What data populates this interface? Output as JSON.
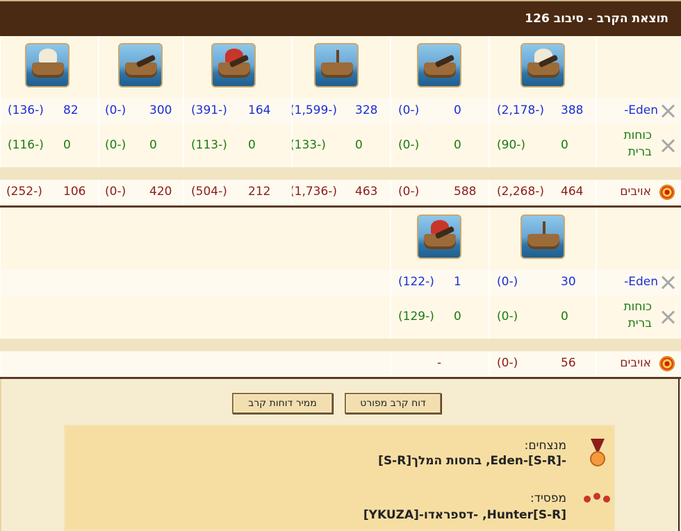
{
  "title": "תוצאת הקרב - סיבוב 126",
  "row_labels": {
    "eden": "Eden-",
    "allies_line1": "כוחות",
    "allies_line2": "ברית",
    "enemies": "אויבים"
  },
  "section1": {
    "icons": [
      "fire-ship-icon",
      "paddle-ship-icon",
      "ballista-ship-icon",
      "catapult-ship-icon",
      "mortar-ship-icon",
      "balloon-carrier-icon"
    ],
    "eden": [
      {
        "count": "388",
        "loss": "(2,178-)"
      },
      {
        "count": "0",
        "loss": "(0-)"
      },
      {
        "count": "328",
        "loss": "(1,599-)"
      },
      {
        "count": "164",
        "loss": "(391-)"
      },
      {
        "count": "300",
        "loss": "(0-)"
      },
      {
        "count": "82",
        "loss": "(136-)"
      }
    ],
    "allies": [
      {
        "count": "0",
        "loss": "(90-)"
      },
      {
        "count": "0",
        "loss": "(0-)"
      },
      {
        "count": "0",
        "loss": "(133-)"
      },
      {
        "count": "0",
        "loss": "(113-)"
      },
      {
        "count": "0",
        "loss": "(0-)"
      },
      {
        "count": "0",
        "loss": "(116-)"
      }
    ],
    "enemies": [
      {
        "count": "464",
        "loss": "(2,268-)"
      },
      {
        "count": "588",
        "loss": "(0-)"
      },
      {
        "count": "463",
        "loss": "(1,736-)"
      },
      {
        "count": "212",
        "loss": "(504-)"
      },
      {
        "count": "420",
        "loss": "(0-)"
      },
      {
        "count": "106",
        "loss": "(252-)"
      }
    ]
  },
  "section2": {
    "icons": [
      "crane-ship-icon",
      "rocket-ship-icon"
    ],
    "eden": [
      {
        "count": "30",
        "loss": "(0-)"
      },
      {
        "count": "1",
        "loss": "(122-)"
      }
    ],
    "allies": [
      {
        "count": "0",
        "loss": "(0-)"
      },
      {
        "count": "0",
        "loss": "(129-)"
      }
    ],
    "enemies": [
      {
        "count": "56",
        "loss": "(0-)"
      },
      {
        "dash": "-"
      }
    ]
  },
  "buttons": {
    "detailed": "דוח קרב מפורט",
    "converter": "ממיר דוחות קרב"
  },
  "summary": {
    "winners_label": "מנצחים:",
    "winners_text": "-[S-R]-Eden, בחסות המלך[S-R]",
    "loser_label": "מפסיד:",
    "loser_text": "Hunter[S-R], -דספראדו-[YKUZA]"
  },
  "colors": {
    "titlebar": "#4a2a12",
    "blue": "#1a2fd4",
    "green": "#1d7a12",
    "maroon": "#8a1d18"
  }
}
